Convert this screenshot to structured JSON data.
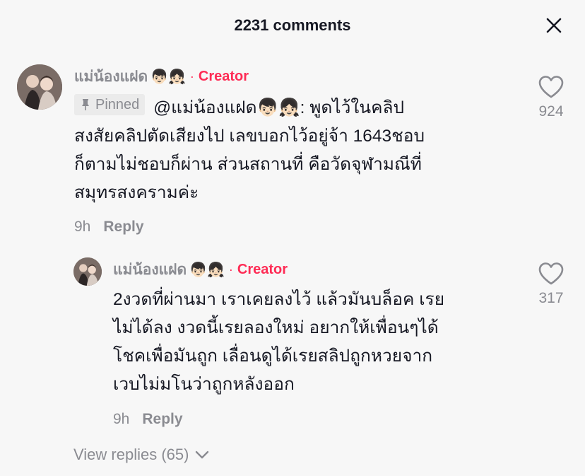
{
  "header": {
    "title": "2231 comments"
  },
  "comments": [
    {
      "username": "แม่น้องแฝด",
      "emoji": "👦🏻👧🏻",
      "badge": "Creator",
      "dot": "·",
      "pinned_label": "Pinned",
      "mention": "@แม่น้องแฝด👦🏻👧🏻:",
      "text_line1": " พูดไว้ในคลิป",
      "text_line2": "สงสัยคลิปตัดเสียงไป เลขบอกไว้อยู่จ้า 1643ชอบ",
      "text_line3": "ก็ตามไม่ชอบก็ผ่าน ส่วนสถานที่ คือวัดจุฬามณีที่",
      "text_line4": "สมุทรสงครามค่ะ",
      "time": "9h",
      "reply_label": "Reply",
      "likes": "924"
    },
    {
      "username": "แม่น้องแฝด",
      "emoji": "👦🏻👧🏻",
      "badge": "Creator",
      "dot": "·",
      "text_line1": "2งวดที่ผ่านมา เราเคยลงไว้ แล้วมันบล็อค เรย",
      "text_line2": "ไม่ได้ลง งวดนี้เรยลองใหม่ อยากให้เพื่อนๆได้",
      "text_line3": "โชคเพื่อมันถูก เลื่อนดูได้เรยสลิปถูกหวยจาก",
      "text_line4": "เวบไม่มโนว่าถูกหลังออก",
      "time": "9h",
      "reply_label": "Reply",
      "likes": "317"
    }
  ],
  "view_replies": "View replies (65)",
  "icons": {
    "close": "close-icon",
    "heart": "heart-outline-icon",
    "pin": "pin-icon",
    "chevron": "chevron-down-icon"
  },
  "colors": {
    "background": "#f7f7f7",
    "creator": "#fe2c55",
    "muted": "#8a8b91",
    "text": "#161823"
  }
}
